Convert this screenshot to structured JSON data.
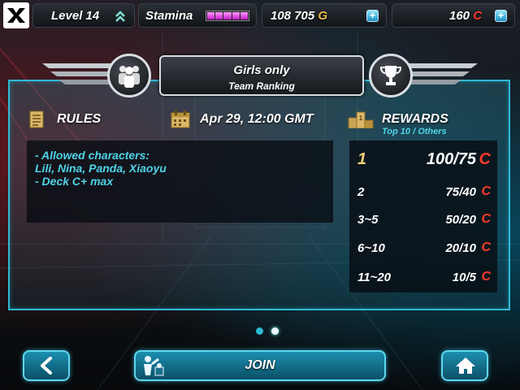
{
  "topbar": {
    "level": "Level 14",
    "stamina_label": "Stamina",
    "stamina_segments": 5,
    "gold": "108 705",
    "gold_icon": "G",
    "coins": "160",
    "coin_icon": "C"
  },
  "banner": {
    "title": "Girls only",
    "subtitle": "Team Ranking",
    "left_icon": "team-icon",
    "right_icon": "trophy-icon"
  },
  "rules": {
    "header": "RULES",
    "date": "Apr 29, 12:00 GMT",
    "lines": [
      "- Allowed characters:",
      "Lili, Nina, Panda, Xiaoyu",
      "- Deck C+ max"
    ]
  },
  "rewards": {
    "header": "REWARDS",
    "subheader": "Top 10 / Others",
    "currency_icon": "C",
    "rows": [
      {
        "rank": "1",
        "value": "100/75"
      },
      {
        "rank": "2",
        "value": "75/40"
      },
      {
        "rank": "3~5",
        "value": "50/20"
      },
      {
        "rank": "6~10",
        "value": "20/10"
      },
      {
        "rank": "11~20",
        "value": "10/5"
      }
    ]
  },
  "pager": {
    "pages": 2,
    "current": 2
  },
  "buttons": {
    "join": "JOIN"
  },
  "colors": {
    "accent": "#2fb9d4",
    "rules_text": "#4fd3e8",
    "coin": "#ff3a2a",
    "gold": "#e8b84a",
    "rank1": "#f3d27a"
  }
}
